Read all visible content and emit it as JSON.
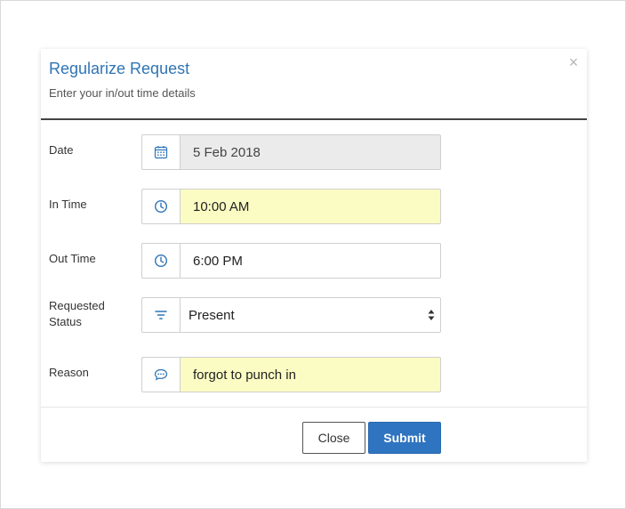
{
  "dialog": {
    "title": "Regularize Request",
    "subtitle": "Enter your in/out time details",
    "close_glyph": "×"
  },
  "fields": {
    "date": {
      "label": "Date",
      "value": "5 Feb 2018",
      "icon": "calendar-icon",
      "disabled": true
    },
    "in_time": {
      "label": "In Time",
      "value": "10:00 AM",
      "icon": "clock-icon",
      "highlighted": true
    },
    "out_time": {
      "label": "Out Time",
      "value": "6:00 PM",
      "icon": "clock-icon"
    },
    "status": {
      "label_line1": "Requested",
      "label_line2": "Status",
      "value": "Present",
      "icon": "filter-icon"
    },
    "reason": {
      "label": "Reason",
      "value": "forgot to punch in",
      "icon": "comment-icon",
      "highlighted": true
    }
  },
  "buttons": {
    "close_label": "Close",
    "submit_label": "Submit"
  },
  "colors": {
    "accent": "#2f74b5",
    "highlight": "#fbfcc3",
    "disabled_bg": "#ebebeb",
    "submit_bg": "#2f74c0"
  }
}
